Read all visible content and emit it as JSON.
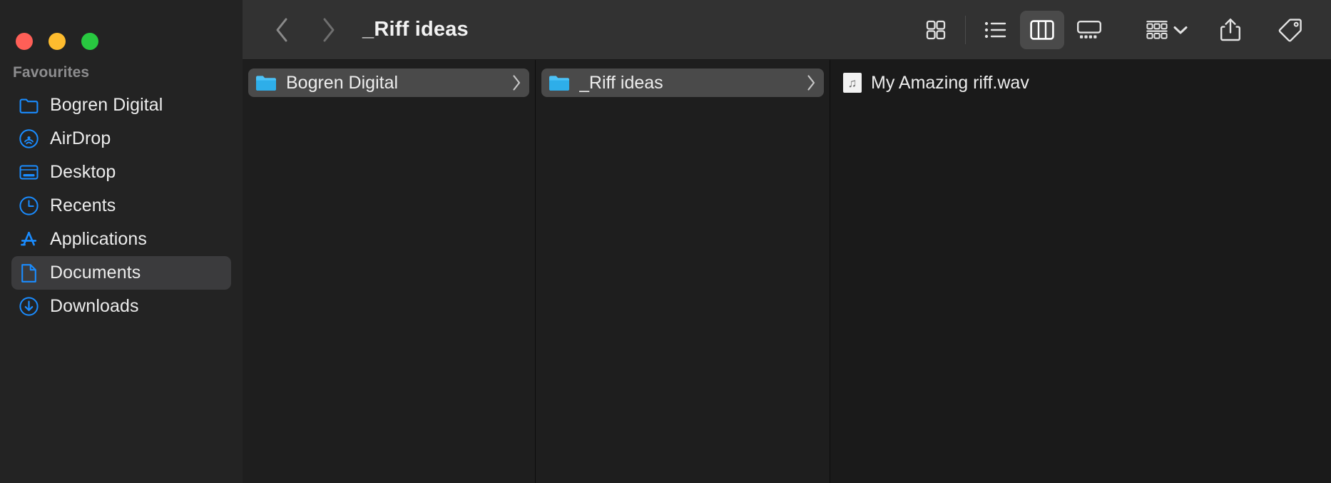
{
  "window": {
    "title": "_Riff ideas",
    "traffic_lights": [
      {
        "name": "close",
        "color": "#ff5f57"
      },
      {
        "name": "minimize",
        "color": "#febc2e"
      },
      {
        "name": "maximize",
        "color": "#28c840"
      }
    ]
  },
  "sidebar": {
    "section_title": "Favourites",
    "items": [
      {
        "label": "Bogren Digital",
        "icon": "folder-icon",
        "selected": false
      },
      {
        "label": "AirDrop",
        "icon": "airdrop-icon",
        "selected": false
      },
      {
        "label": "Desktop",
        "icon": "desktop-icon",
        "selected": false
      },
      {
        "label": "Recents",
        "icon": "clock-icon",
        "selected": false
      },
      {
        "label": "Applications",
        "icon": "applications-icon",
        "selected": false
      },
      {
        "label": "Documents",
        "icon": "document-icon",
        "selected": true
      },
      {
        "label": "Downloads",
        "icon": "download-icon",
        "selected": false
      }
    ]
  },
  "toolbar": {
    "back_label": "Back",
    "forward_label": "Forward",
    "title": "_Riff ideas",
    "view_modes": [
      {
        "name": "icon-view",
        "label": "as Icons",
        "active": false
      },
      {
        "name": "list-view",
        "label": "as List",
        "active": false
      },
      {
        "name": "column-view",
        "label": "as Columns",
        "active": true
      },
      {
        "name": "gallery-view",
        "label": "as Gallery",
        "active": false
      }
    ],
    "group_label": "Group",
    "share_label": "Share",
    "tags_label": "Tags"
  },
  "columns": [
    {
      "name": "column-1",
      "items": [
        {
          "label": "Bogren Digital",
          "icon": "folder-icon",
          "selected": true,
          "has_chevron": true
        }
      ]
    },
    {
      "name": "column-2",
      "items": [
        {
          "label": "_Riff ideas",
          "icon": "folder-icon",
          "selected": true,
          "has_chevron": true
        }
      ]
    },
    {
      "name": "column-3",
      "items": [
        {
          "label": "My Amazing riff.wav",
          "icon": "audio-file-icon",
          "selected": false,
          "has_chevron": false
        }
      ]
    }
  ],
  "colors": {
    "accent": "#1a8cff",
    "sidebar_bg": "#232323",
    "toolbar_bg": "#323232",
    "content_bg": "#1e1e1e",
    "selection": "#4a4a4a"
  }
}
